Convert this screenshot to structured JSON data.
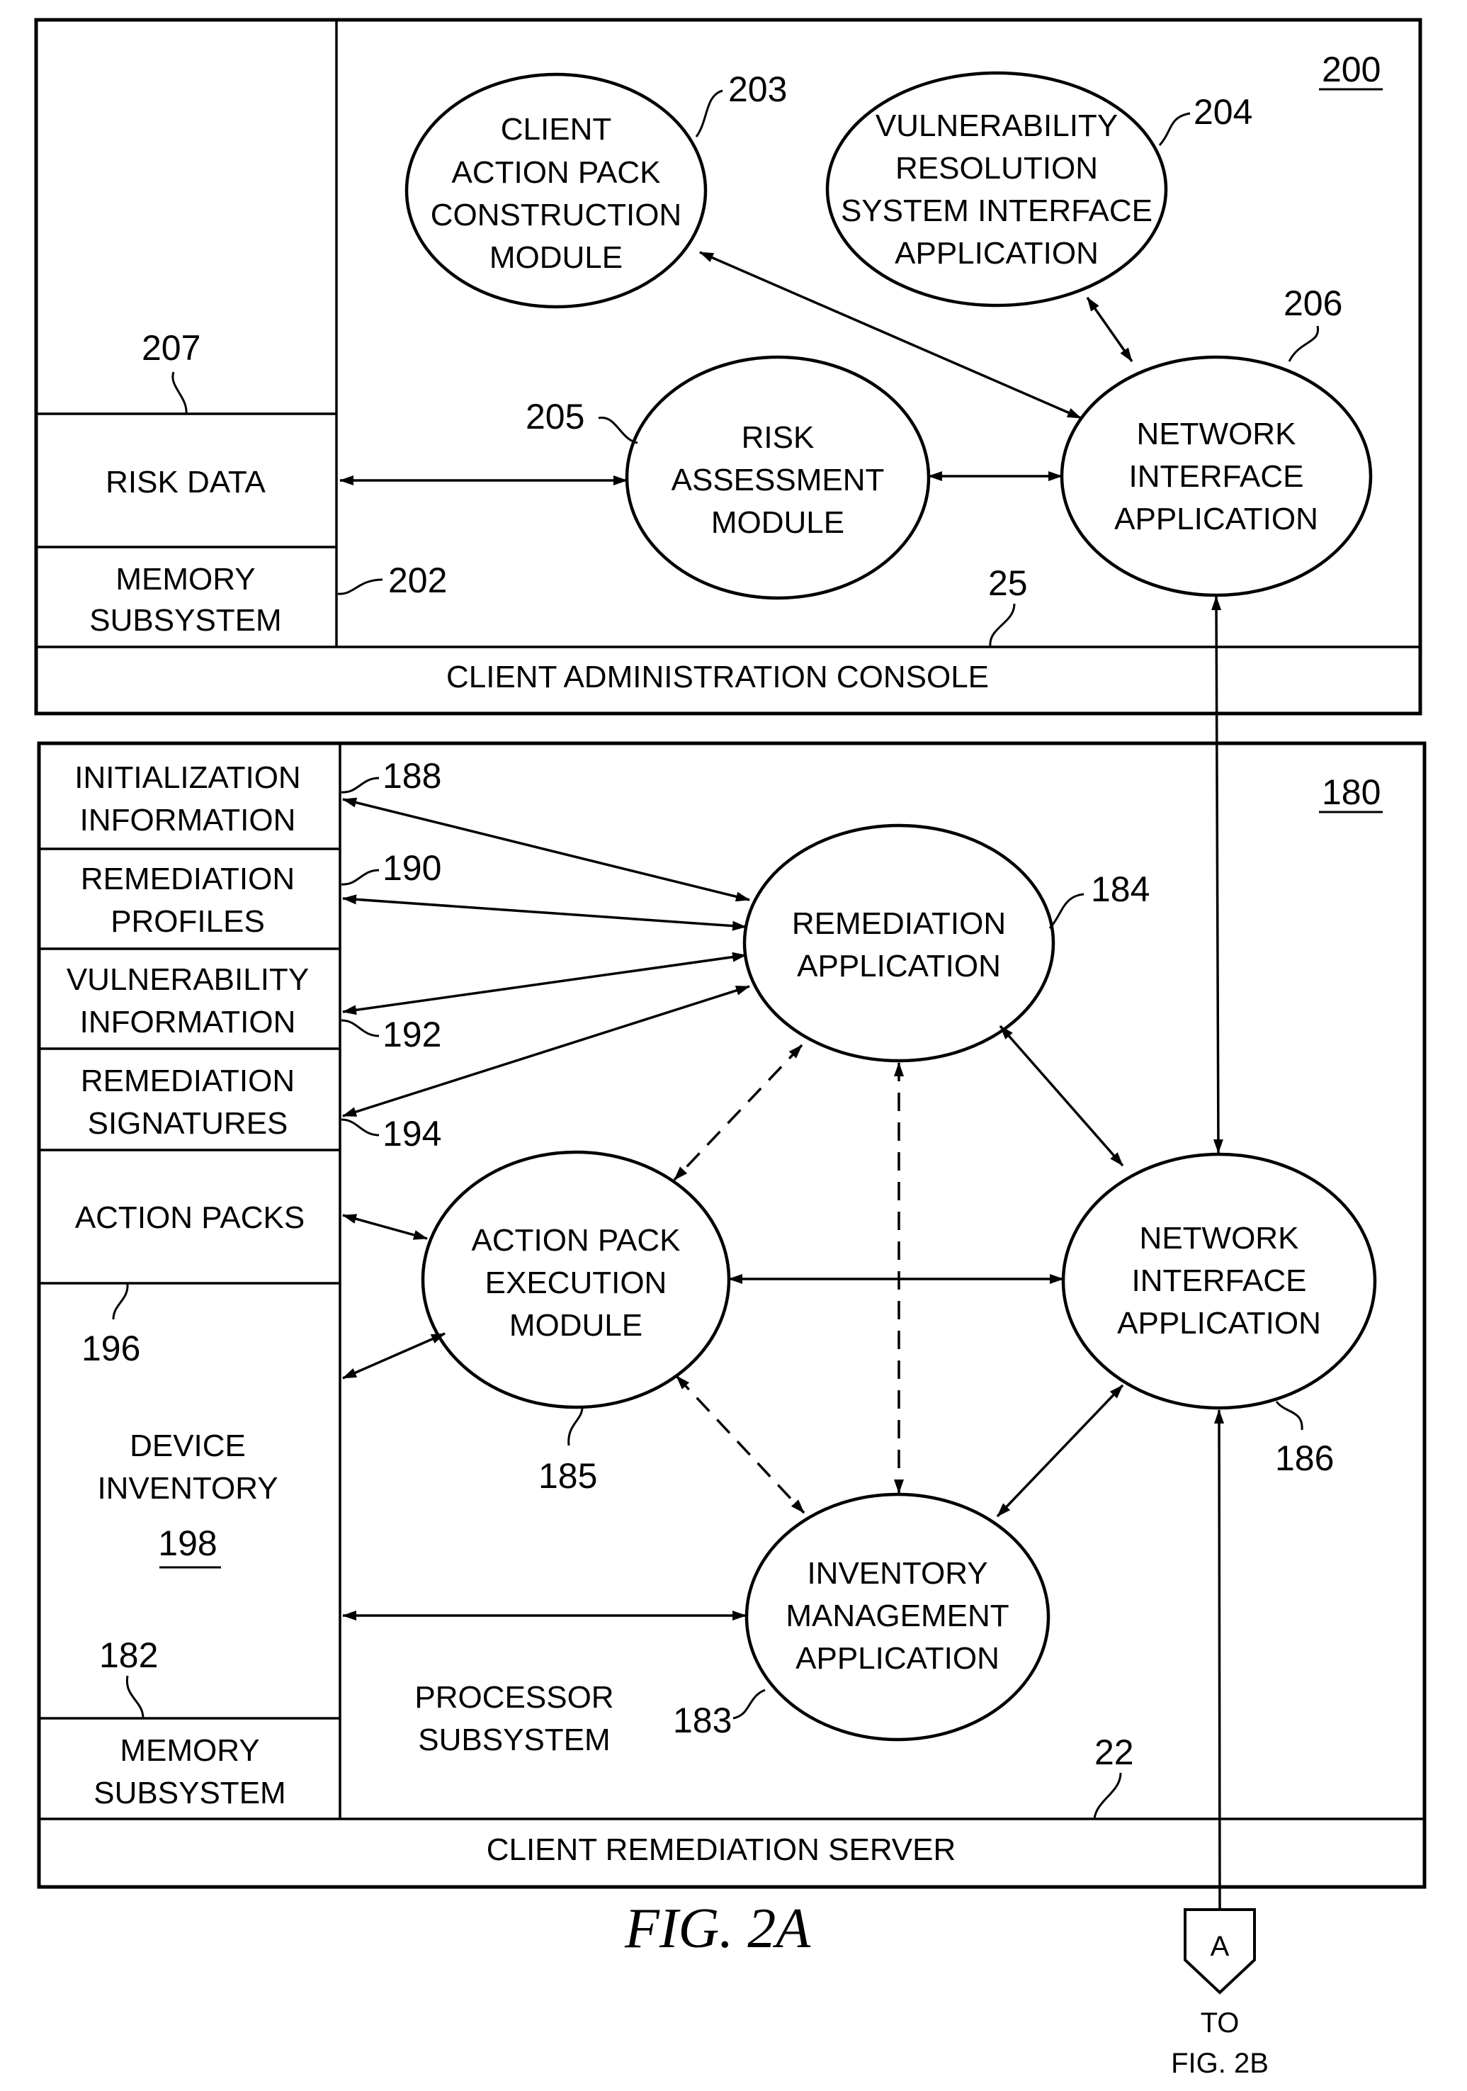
{
  "figure": {
    "caption": "FIG. 2A",
    "offpage_connector": {
      "letter": "A",
      "line1": "TO",
      "line2": "FIG. 2B"
    }
  },
  "console": {
    "ref": "200",
    "bar_label": "CLIENT ADMINISTRATION CONSOLE",
    "bar_ref": "25",
    "memory": {
      "ref": "202",
      "label": [
        "MEMORY",
        "SUBSYSTEM"
      ],
      "risk_data": {
        "ref": "207",
        "label": "RISK DATA"
      }
    },
    "modules": [
      {
        "id": "203",
        "lines": [
          "CLIENT",
          "ACTION PACK",
          "CONSTRUCTION",
          "MODULE"
        ]
      },
      {
        "id": "204",
        "lines": [
          "VULNERABILITY",
          "RESOLUTION",
          "SYSTEM INTERFACE",
          "APPLICATION"
        ]
      },
      {
        "id": "205",
        "lines": [
          "RISK",
          "ASSESSMENT",
          "MODULE"
        ]
      },
      {
        "id": "206",
        "lines": [
          "NETWORK",
          "INTERFACE",
          "APPLICATION"
        ]
      }
    ]
  },
  "server": {
    "ref": "180",
    "bar_label": "CLIENT REMEDIATION SERVER",
    "bar_ref": "22",
    "processor_label": [
      "PROCESSOR",
      "SUBSYSTEM"
    ],
    "memory": {
      "ref": "182",
      "label": [
        "MEMORY",
        "SUBSYSTEM"
      ],
      "stores": [
        {
          "ref": "188",
          "lines": [
            "INITIALIZATION",
            "INFORMATION"
          ]
        },
        {
          "ref": "190",
          "lines": [
            "REMEDIATION",
            "PROFILES"
          ]
        },
        {
          "ref": "192",
          "lines": [
            "VULNERABILITY",
            "INFORMATION"
          ]
        },
        {
          "ref": "194",
          "lines": [
            "REMEDIATION",
            "SIGNATURES"
          ]
        },
        {
          "ref": "196",
          "lines": [
            "ACTION PACKS"
          ]
        },
        {
          "ref": "198",
          "lines": [
            "DEVICE",
            "INVENTORY"
          ]
        }
      ]
    },
    "modules": [
      {
        "id": "184",
        "lines": [
          "REMEDIATION",
          "APPLICATION"
        ]
      },
      {
        "id": "185",
        "lines": [
          "ACTION PACK",
          "EXECUTION",
          "MODULE"
        ]
      },
      {
        "id": "186",
        "lines": [
          "NETWORK",
          "INTERFACE",
          "APPLICATION"
        ]
      },
      {
        "id": "183",
        "lines": [
          "INVENTORY",
          "MANAGEMENT",
          "APPLICATION"
        ]
      }
    ]
  }
}
